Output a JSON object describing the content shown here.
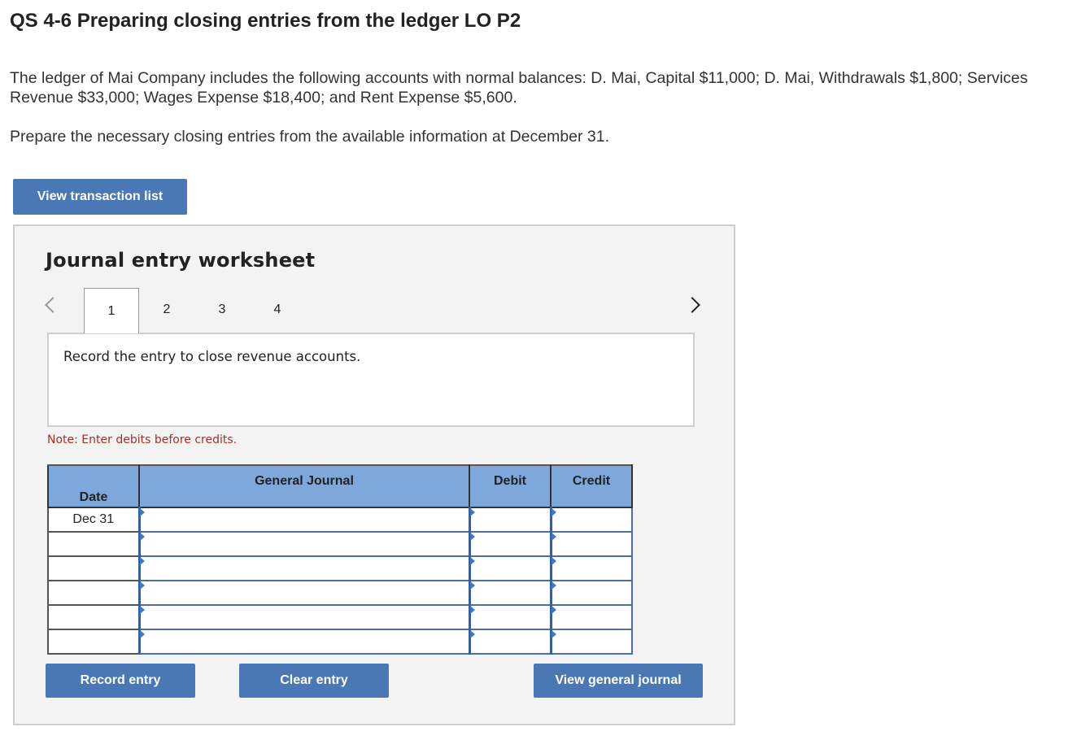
{
  "header": {
    "title": "QS 4-6 Preparing closing entries from the ledger LO P2"
  },
  "problem": {
    "paragraph_1": "The ledger of Mai Company includes the following accounts with normal balances: D. Mai, Capital $11,000; D. Mai, Withdrawals $1,800; Services Revenue $33,000; Wages Expense $18,400; and Rent Expense $5,600.",
    "paragraph_2": "Prepare the necessary closing entries from the available information at December 31."
  },
  "buttons": {
    "view_transaction_list": "View transaction list",
    "record_entry": "Record entry",
    "clear_entry": "Clear entry",
    "view_general_journal": "View general journal"
  },
  "worksheet": {
    "title": "Journal entry worksheet",
    "tabs": [
      {
        "label": "1",
        "active": true
      },
      {
        "label": "2",
        "active": false
      },
      {
        "label": "3",
        "active": false
      },
      {
        "label": "4",
        "active": false
      }
    ],
    "instruction": "Record the entry to close revenue accounts.",
    "note": "Note: Enter debits before credits."
  },
  "journal": {
    "headers": {
      "date": "Date",
      "general_journal": "General Journal",
      "debit": "Debit",
      "credit": "Credit"
    },
    "rows": [
      {
        "date": "Dec 31",
        "account": "",
        "debit": "",
        "credit": ""
      },
      {
        "date": "",
        "account": "",
        "debit": "",
        "credit": ""
      },
      {
        "date": "",
        "account": "",
        "debit": "",
        "credit": ""
      },
      {
        "date": "",
        "account": "",
        "debit": "",
        "credit": ""
      },
      {
        "date": "",
        "account": "",
        "debit": "",
        "credit": ""
      },
      {
        "date": "",
        "account": "",
        "debit": "",
        "credit": ""
      }
    ]
  },
  "colors": {
    "button_blue": "#4a78b5",
    "header_blue": "#7ea8dc",
    "note_red": "#a0302a",
    "panel_gray": "#f3f3f3"
  },
  "icons": {
    "prev": "chevron-left-icon",
    "next": "chevron-right-icon",
    "cell_marker": "triangle-right-icon"
  }
}
